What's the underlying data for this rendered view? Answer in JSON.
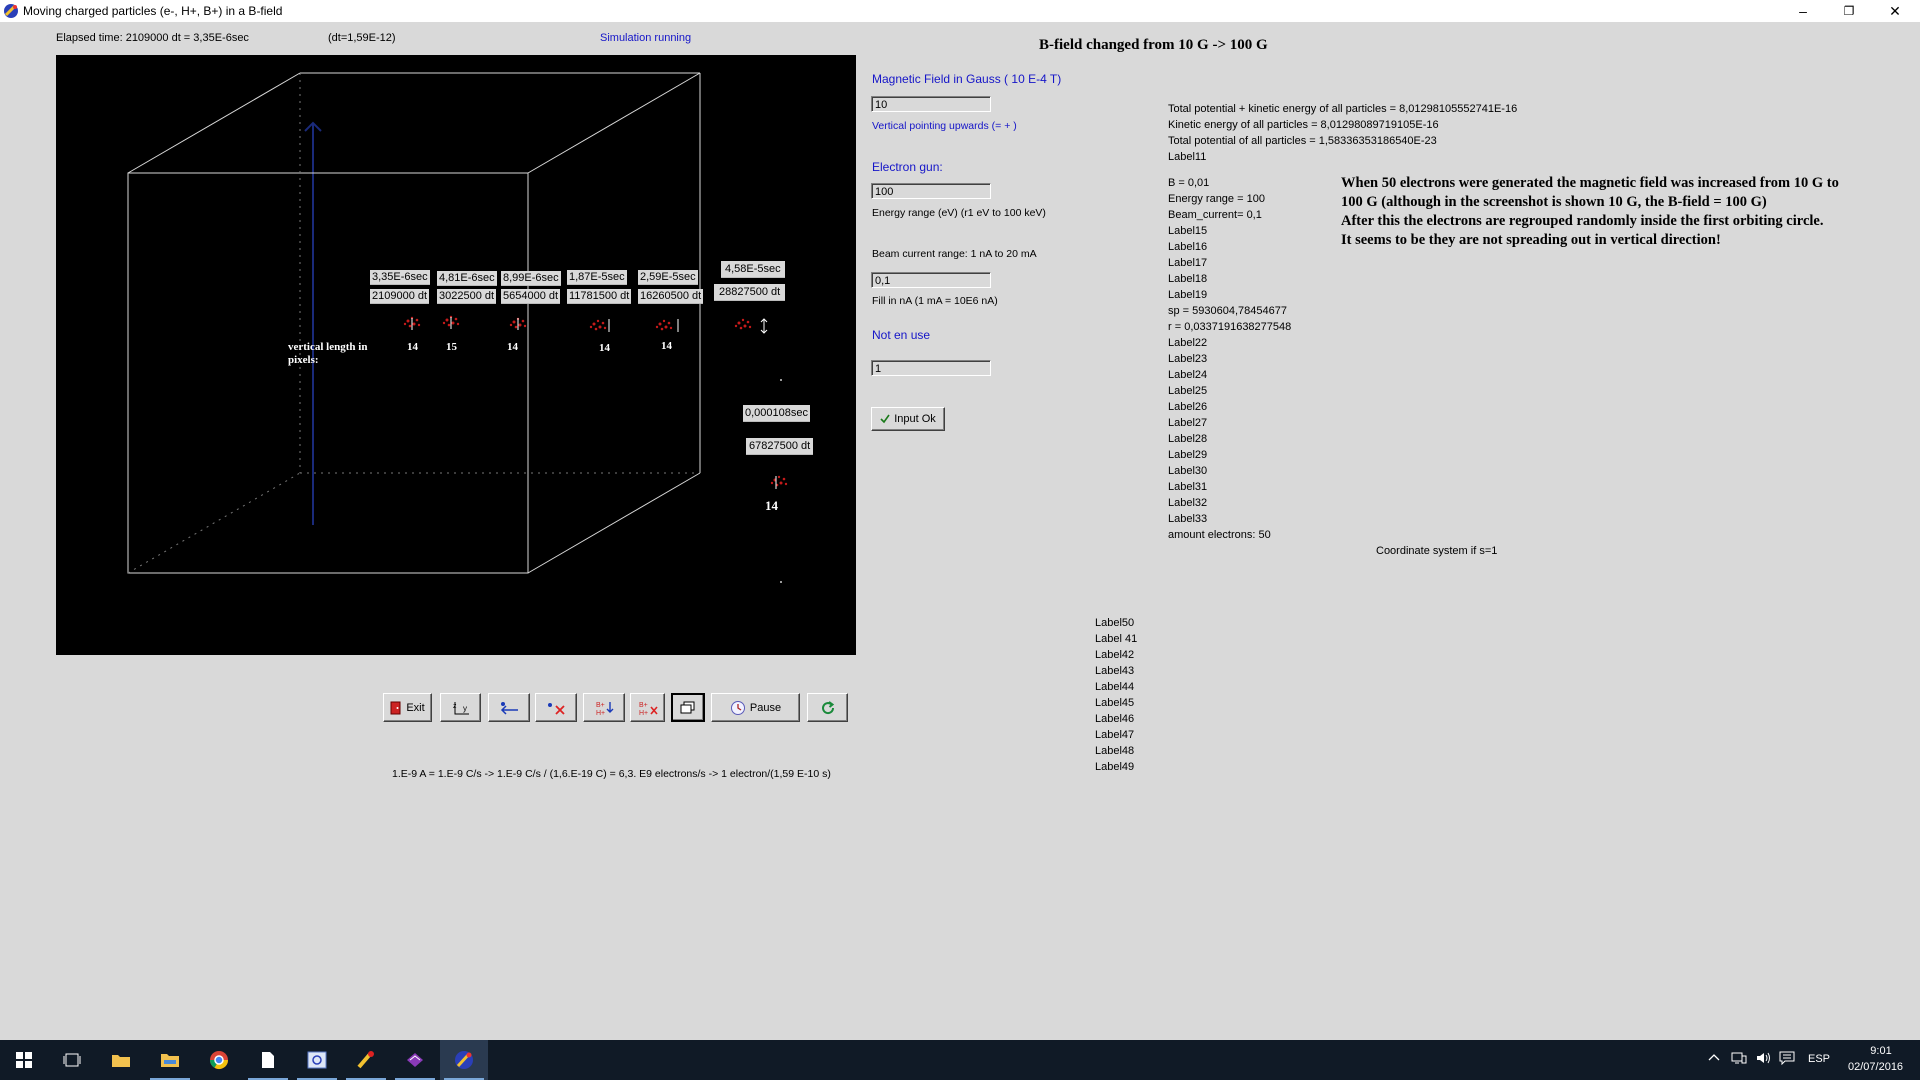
{
  "window": {
    "title": "Moving charged particles (e-, H+, B+) in a B-field",
    "minimize": "–",
    "restore": "❐",
    "close": "✕"
  },
  "status": {
    "elapsed": "Elapsed time: 2109000 dt   = 3,35E-6sec",
    "dt": "(dt=1,59E-12)",
    "running": "Simulation running"
  },
  "heading": "B-field changed from 10 G -> 100 G",
  "canvas": {
    "vertical_label_1": "vertical length in",
    "vertical_label_2": "pixels:",
    "snapshots": [
      {
        "time": "3,35E-6sec",
        "dt": "2109000 dt",
        "count": "14"
      },
      {
        "time": "4,81E-6sec",
        "dt": "3022500 dt",
        "count": "15"
      },
      {
        "time": "8,99E-6sec",
        "dt": "5654000 dt",
        "count": "14"
      },
      {
        "time": "1,87E-5sec",
        "dt": "11781500 dt",
        "count": "14"
      },
      {
        "time": "2,59E-5sec",
        "dt": "16260500 dt",
        "count": "14"
      },
      {
        "time": "4,58E-5sec",
        "dt": "28827500 dt",
        "count": ""
      }
    ],
    "last_time": "0,000108sec",
    "last_dt": "67827500 dt",
    "last_count": "14"
  },
  "form": {
    "bfield_label": "Magnetic Field in Gauss ( 10 E-4 T)",
    "bfield_value": "10",
    "bfield_direction": "Vertical pointing upwards (= + )",
    "gun_label": "Electron gun:",
    "gun_value": "100",
    "energy_range": "Energy range (eV)     (r1 eV to 100 keV)",
    "beam_range": "Beam current range: 1 nA to 20 mA",
    "beam_value": "0,1",
    "beam_fill": "Fill in nA (1 mA = 10E6 nA)",
    "unused_label": "Not en use",
    "unused_value": "1",
    "input_ok": "Input Ok",
    "input_ok_icon": "checkmark-icon"
  },
  "energies": {
    "total": "Total potential + kinetic energy of all particles = 8,01298105552741E-16",
    "kinetic": "Kinetic energy of all particles = 8,01298089719105E-16",
    "potential": "Total potential of all particles = 1,58336353186540E-23",
    "label11": "Label11"
  },
  "params": [
    "B = 0,01",
    "Energy range = 100",
    "Beam_current= 0,1",
    "Label15",
    "Label16",
    "Label17",
    "Label18",
    "Label19",
    "sp =  5930604,78454677",
    "r =  0,0337191638277548",
    "Label22",
    "Label23",
    "Label24",
    "Label25",
    "Label26",
    "Label27",
    "Label28",
    "Label29",
    "Label30",
    "Label31",
    "Label32",
    "Label33",
    "amount electrons: 50"
  ],
  "coordinate_label": "Coordinate system if s=1",
  "note": [
    "When 50 electrons were generated the magnetic field was increased from 10 G to 100 G (although in the screenshot is shown 10 G, the B-field = 100 G)",
    "After this the electrons are regrouped randomly inside the first orbiting circle.",
    "It seems to be they are not spreading out in vertical direction!"
  ],
  "labels_lower": [
    "Label50",
    "Label 41",
    "Label42",
    "Label43",
    "Label44",
    "Label45",
    "Label46",
    "Label47",
    "Label48",
    "Label49"
  ],
  "toolbar": {
    "exit": "Exit",
    "pause": "Pause"
  },
  "formula": "1.E-9 A = 1.E-9 C/s  ->  1.E-9 C/s / (1,6.E-19 C) = 6,3. E9   electrons/s  -> 1 electron/(1,59 E-10 s)",
  "taskbar": {
    "lang": "ESP",
    "time": "9:01",
    "date": "02/07/2016"
  }
}
